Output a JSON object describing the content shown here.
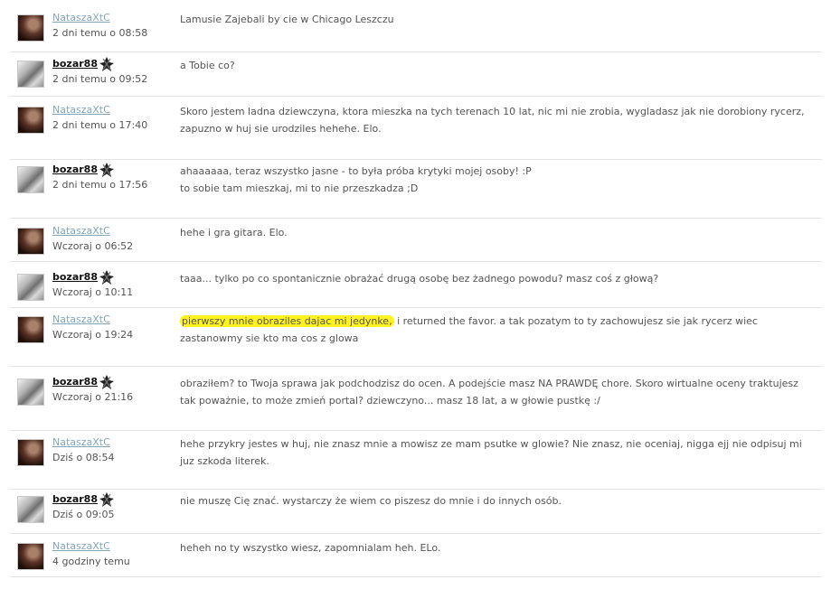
{
  "comments": [
    {
      "user": "NataszaXtC",
      "time": "2 dni temu o 08:58",
      "text": "Lamusie Zajebali by cie w Chicago Leszczu"
    },
    {
      "user": "bozar88",
      "time": "2 dni temu o 09:52",
      "text": "a Tobie co?"
    },
    {
      "user": "NataszaXtC",
      "time": "2 dni temu o 17:40",
      "text": "Skoro jestem ladna dziewczyna, ktora mieszka na tych terenach 10 lat, nic mi nie zrobia, wygladasz jak nie dorobiony rycerz,\nzapuzno w huj sie urodziles hehehe. Elo."
    },
    {
      "user": "bozar88",
      "time": "2 dni temu o 17:56",
      "text": "ahaaaaaa, teraz wszystko jasne - to była próba krytyki mojej osoby! :P\nto sobie tam mieszkaj, mi to nie przeszkadza ;D"
    },
    {
      "user": "NataszaXtC",
      "time": "Wczoraj o 06:52",
      "text": "hehe i gra gitara. Elo."
    },
    {
      "user": "bozar88",
      "time": "Wczoraj o 10:11",
      "text": "taaa... tylko po co spontanicznie obrażać drugą osobę bez żadnego powodu? masz coś z głową?"
    },
    {
      "user": "NataszaXtC",
      "time": "Wczoraj o 19:24",
      "text_highlight": "pierwszy mnie obraziles dajac mi jedynke,",
      "text": " i returned the favor. a tak pozatym to ty zachowujesz sie jak rycerz wiec\nzastanowmy sie kto ma cos z glowa"
    },
    {
      "user": "bozar88",
      "time": "Wczoraj o 21:16",
      "text": "obraziłem? to Twoja sprawa jak podchodzisz do ocen. A podejście masz NA PRAWDĘ chore. Skoro wirtualne oceny traktujesz\ntak poważnie, to może zmień portal? dziewczyno... masz 18 lat, a w głowie pustkę :/"
    },
    {
      "user": "NataszaXtC",
      "time": "Dziś o 08:54",
      "text": "hehe przykry jestes w huj, nie znasz mnie a mowisz ze mam psutke w glowie? Nie znasz, nie oceniaj, nigga ejj nie odpisuj mi\njuz szkoda literek."
    },
    {
      "user": "bozar88",
      "time": "Dziś o 09:05",
      "text": "nie muszę Cię znać. wystarczy że wiem co piszesz do mnie i do innych osób."
    },
    {
      "user": "NataszaXtC",
      "time": "4 godziny temu",
      "text": "heheh no ty wszystko wiesz, zapomnialam heh. ELo."
    }
  ]
}
